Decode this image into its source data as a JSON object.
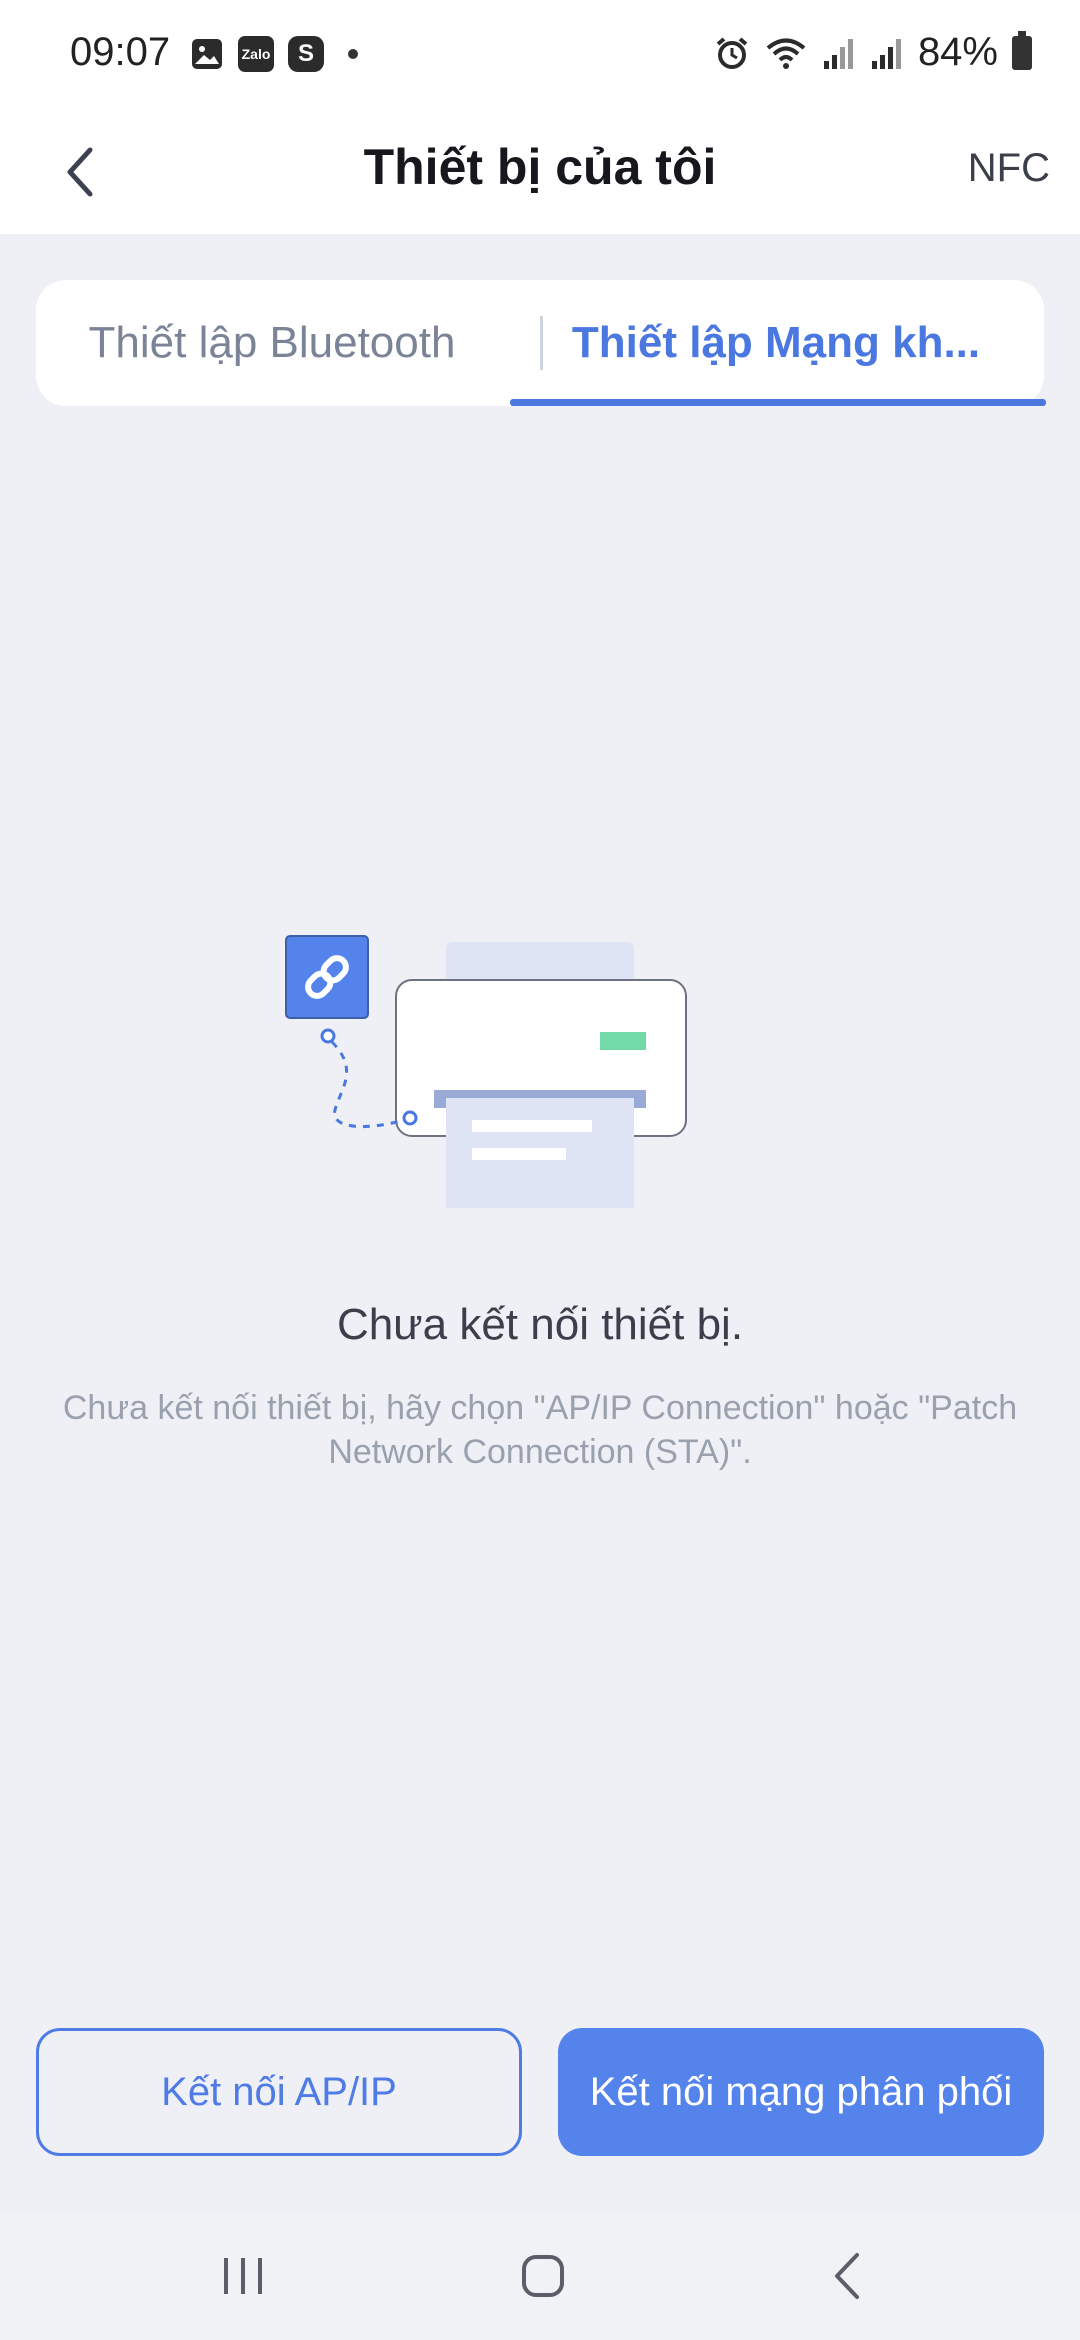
{
  "status_bar": {
    "time": "09:07",
    "battery": "84%",
    "left_icons": [
      "gallery-icon",
      "zalo-icon",
      "skype-icon",
      "dot-icon"
    ],
    "right_icons": [
      "alarm-icon",
      "wifi-icon",
      "signal-icon",
      "signal-icon",
      "battery-icon"
    ],
    "zalo_label": "Zalo",
    "skype_label": "S"
  },
  "header": {
    "title": "Thiết bị của tôi",
    "nfc_label": "NFC",
    "back_icon": "chevron-left-icon"
  },
  "tabs": [
    {
      "label": "Thiết lập Bluetooth",
      "active": false
    },
    {
      "label": "Thiết lập Mạng kh...",
      "active": true
    }
  ],
  "empty_state": {
    "title": "Chưa kết nối thiết bị.",
    "description": "Chưa kết nối thiết bị, hãy chọn \"AP/IP Connection\" hoặc \"Patch Network Connection (STA)\".",
    "illustration": "printer-disconnected-illustration"
  },
  "actions": {
    "ap_label": "Kết nối AP/IP",
    "sta_label": "Kết nối mạng phân phối"
  },
  "colors": {
    "accent": "#4a78e0",
    "button_fill": "#5483ec",
    "background": "#eff0f6"
  },
  "nav": [
    "recent-apps-icon",
    "home-icon",
    "back-icon"
  ]
}
